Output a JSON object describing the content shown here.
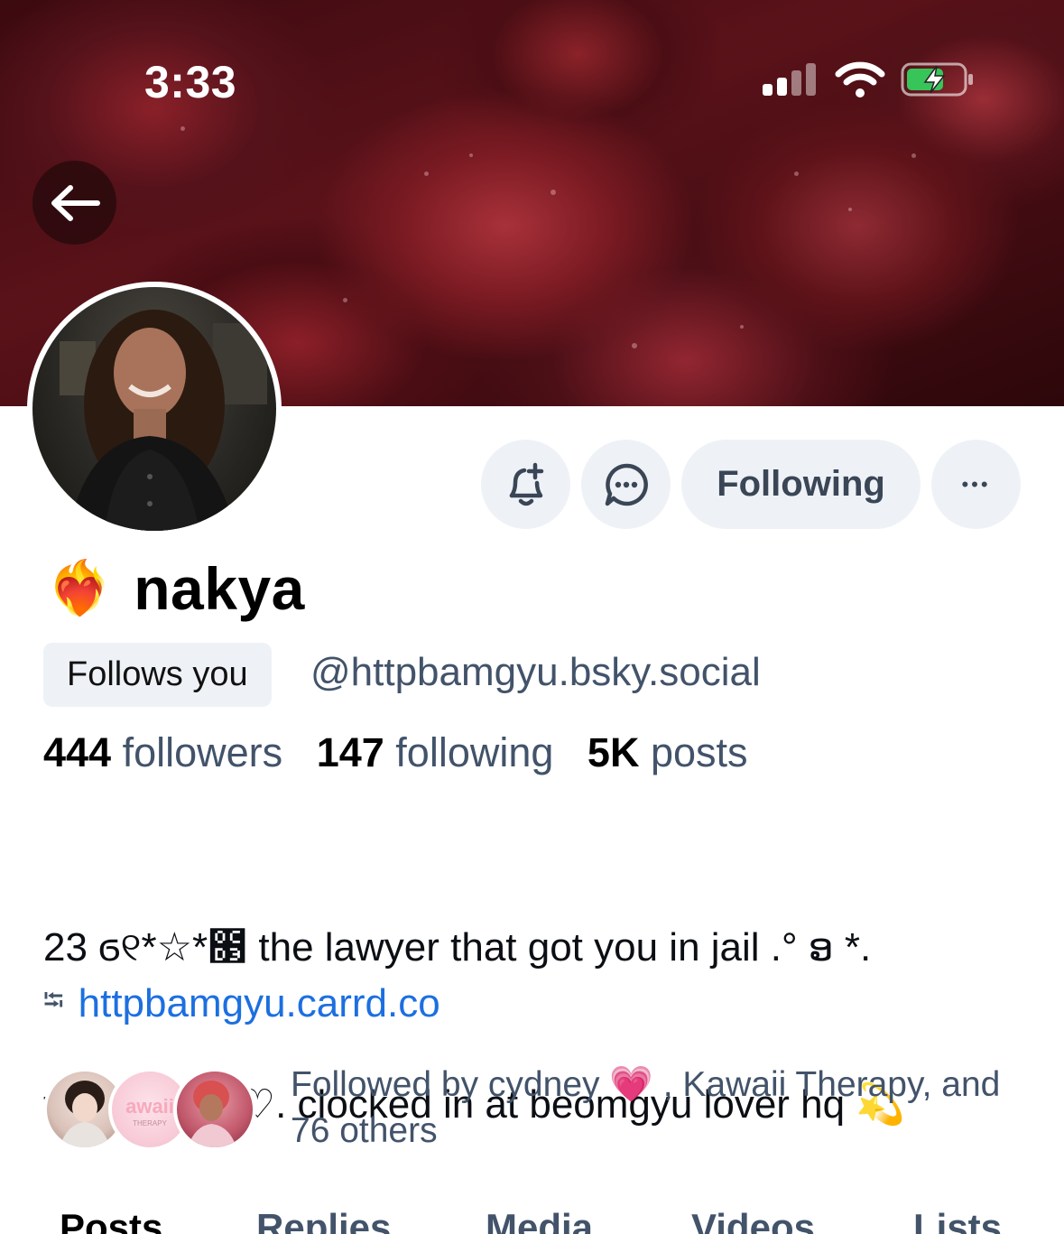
{
  "status_bar": {
    "time": "3:33"
  },
  "profile": {
    "name_emoji": "❤️‍🔥",
    "display_name": "nakya",
    "follows_you_label": "Follows you",
    "handle": "@httpbamgyu.bsky.social",
    "stats": {
      "followers_count": "444",
      "followers_label": "followers",
      "following_count": "147",
      "following_label": "following",
      "posts_count": "5K",
      "posts_label": "posts"
    },
    "bio_line1": "23 ϭ୧*☆*೓ the lawyer that got you in jail .° ອ *.",
    "bio_line2": "they/them .♡. clocked in at beomgyu lover hq 💫",
    "link_icon": "⭾",
    "link_text": "httpbamgyu.carrd.co",
    "followed_by_text": "Followed by cydney 💗 , Kawaii Therapy, and 76 others"
  },
  "actions": {
    "following_label": "Following",
    "more_label": "•••"
  },
  "tabs": [
    "Posts",
    "Replies",
    "Media",
    "Videos",
    "Lists"
  ],
  "colors": {
    "accent_link": "#1c6fe0",
    "muted_text": "#42536a",
    "button_bg": "#eef2f6"
  },
  "icons": [
    "back-arrow-icon",
    "bell-plus-icon",
    "chat-bubble-icon",
    "link-icon"
  ]
}
